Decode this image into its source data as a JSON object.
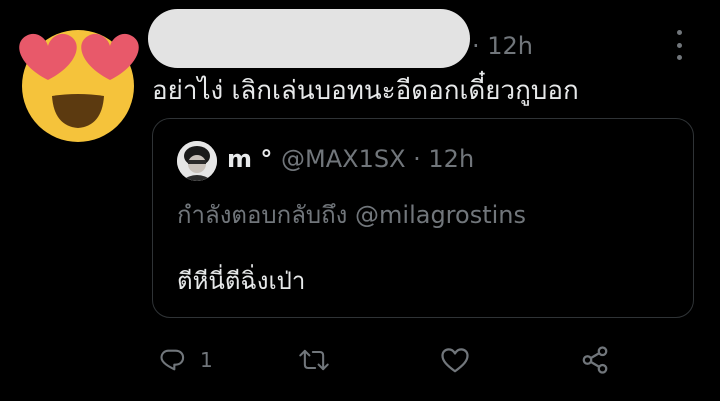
{
  "tweet": {
    "time": "· 12h",
    "text": "อย่าไง่ เลิกเล่นบอทนะอีดอกเดี๋ยวกูบอก",
    "avatar_icon": "smiling-face-with-heart-eyes-emoji",
    "more_icon": "more-options-icon"
  },
  "quote": {
    "name": "m °",
    "handle": "@MAX1SX · 12h",
    "replying_to": "กำลังตอบกลับถึง @milagrostins",
    "text": "ตีหีนี่ตีฉิ่งเป่า"
  },
  "actions": {
    "reply_count": "1",
    "icons": [
      "reply-icon",
      "retweet-icon",
      "like-icon",
      "share-icon"
    ]
  },
  "colors": {
    "background": "#000000",
    "text_primary": "#e7e9ea",
    "text_secondary": "#71767b",
    "border": "#2f3336",
    "redaction": "#e3e3e3",
    "emoji_face": "#f5c33b",
    "emoji_heart": "#e8596a",
    "emoji_mouth": "#5c3a10"
  }
}
